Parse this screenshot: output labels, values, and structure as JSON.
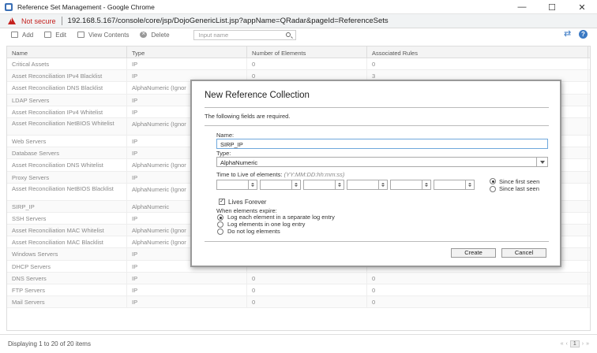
{
  "window": {
    "title": "Reference Set Management - Google Chrome",
    "minimize": "—",
    "maximize": "☐",
    "close": "✕"
  },
  "address": {
    "security_label": "Not secure",
    "url": "192.168.5.167/console/core/jsp/DojoGenericList.jsp?appName=QRadar&pageId=ReferenceSets"
  },
  "toolbar": {
    "add": "Add",
    "edit": "Edit",
    "view_contents": "View Contents",
    "delete": "Delete",
    "search_placeholder": "Input name",
    "help": "?"
  },
  "table": {
    "columns": [
      "Name",
      "Type",
      "Number of Elements",
      "Associated Rules"
    ],
    "rows": [
      {
        "name": "Critical Assets",
        "type": "IP",
        "elements": "0",
        "rules": "0"
      },
      {
        "name": "Asset Reconciliation IPv4 Blacklist",
        "type": "IP",
        "elements": "0",
        "rules": "3"
      },
      {
        "name": "Asset Reconciliation DNS Blacklist",
        "type": "AlphaNumeric (Ignor",
        "elements": "",
        "rules": ""
      },
      {
        "name": "LDAP Servers",
        "type": "IP",
        "elements": "",
        "rules": ""
      },
      {
        "name": "Asset Reconciliation IPv4 Whitelist",
        "type": "IP",
        "elements": "",
        "rules": ""
      },
      {
        "name": "Asset Reconciliation NetBIOS Whitelist",
        "type": "AlphaNumeric (Ignor",
        "elements": "",
        "rules": ""
      },
      {
        "name": "Web Servers",
        "type": "IP",
        "elements": "",
        "rules": ""
      },
      {
        "name": "Database Servers",
        "type": "IP",
        "elements": "",
        "rules": ""
      },
      {
        "name": "Asset Reconciliation DNS Whitelist",
        "type": "AlphaNumeric (Ignor",
        "elements": "",
        "rules": ""
      },
      {
        "name": "Proxy Servers",
        "type": "IP",
        "elements": "",
        "rules": ""
      },
      {
        "name": "Asset Reconciliation NetBIOS Blacklist",
        "type": "AlphaNumeric (Ignor",
        "elements": "",
        "rules": ""
      },
      {
        "name": "SIRP_IP",
        "type": "AlphaNumeric",
        "elements": "",
        "rules": ""
      },
      {
        "name": "SSH Servers",
        "type": "IP",
        "elements": "",
        "rules": ""
      },
      {
        "name": "Asset Reconciliation MAC Whitelist",
        "type": "AlphaNumeric (Ignor",
        "elements": "",
        "rules": ""
      },
      {
        "name": "Asset Reconciliation MAC Blacklist",
        "type": "AlphaNumeric (Ignor",
        "elements": "",
        "rules": ""
      },
      {
        "name": "Windows Servers",
        "type": "IP",
        "elements": "",
        "rules": ""
      },
      {
        "name": "DHCP Servers",
        "type": "IP",
        "elements": "",
        "rules": ""
      },
      {
        "name": "DNS Servers",
        "type": "IP",
        "elements": "0",
        "rules": "0"
      },
      {
        "name": "FTP Servers",
        "type": "IP",
        "elements": "0",
        "rules": "0"
      },
      {
        "name": "Mail Servers",
        "type": "IP",
        "elements": "0",
        "rules": "0"
      }
    ]
  },
  "footer": {
    "info": "Displaying 1 to 20 of 20 items",
    "page": "1"
  },
  "dialog": {
    "title": "New Reference Collection",
    "required_note": "The following fields are required.",
    "name_label": "Name:",
    "name_value": "SIRP_IP",
    "type_label": "Type:",
    "type_value": "AlphaNumeric",
    "ttl_label": "Time to Live of elements:",
    "ttl_hint": "(YY:MM:DD:hh:mm:ss)",
    "since_first_seen": "Since first seen",
    "since_last_seen": "Since last seen",
    "lives_forever": "Lives Forever",
    "expire_label": "When elements expire:",
    "expire_options": [
      "Log each element in a separate log entry",
      "Log elements in one log entry",
      "Do not log elements"
    ],
    "create": "Create",
    "cancel": "Cancel"
  }
}
